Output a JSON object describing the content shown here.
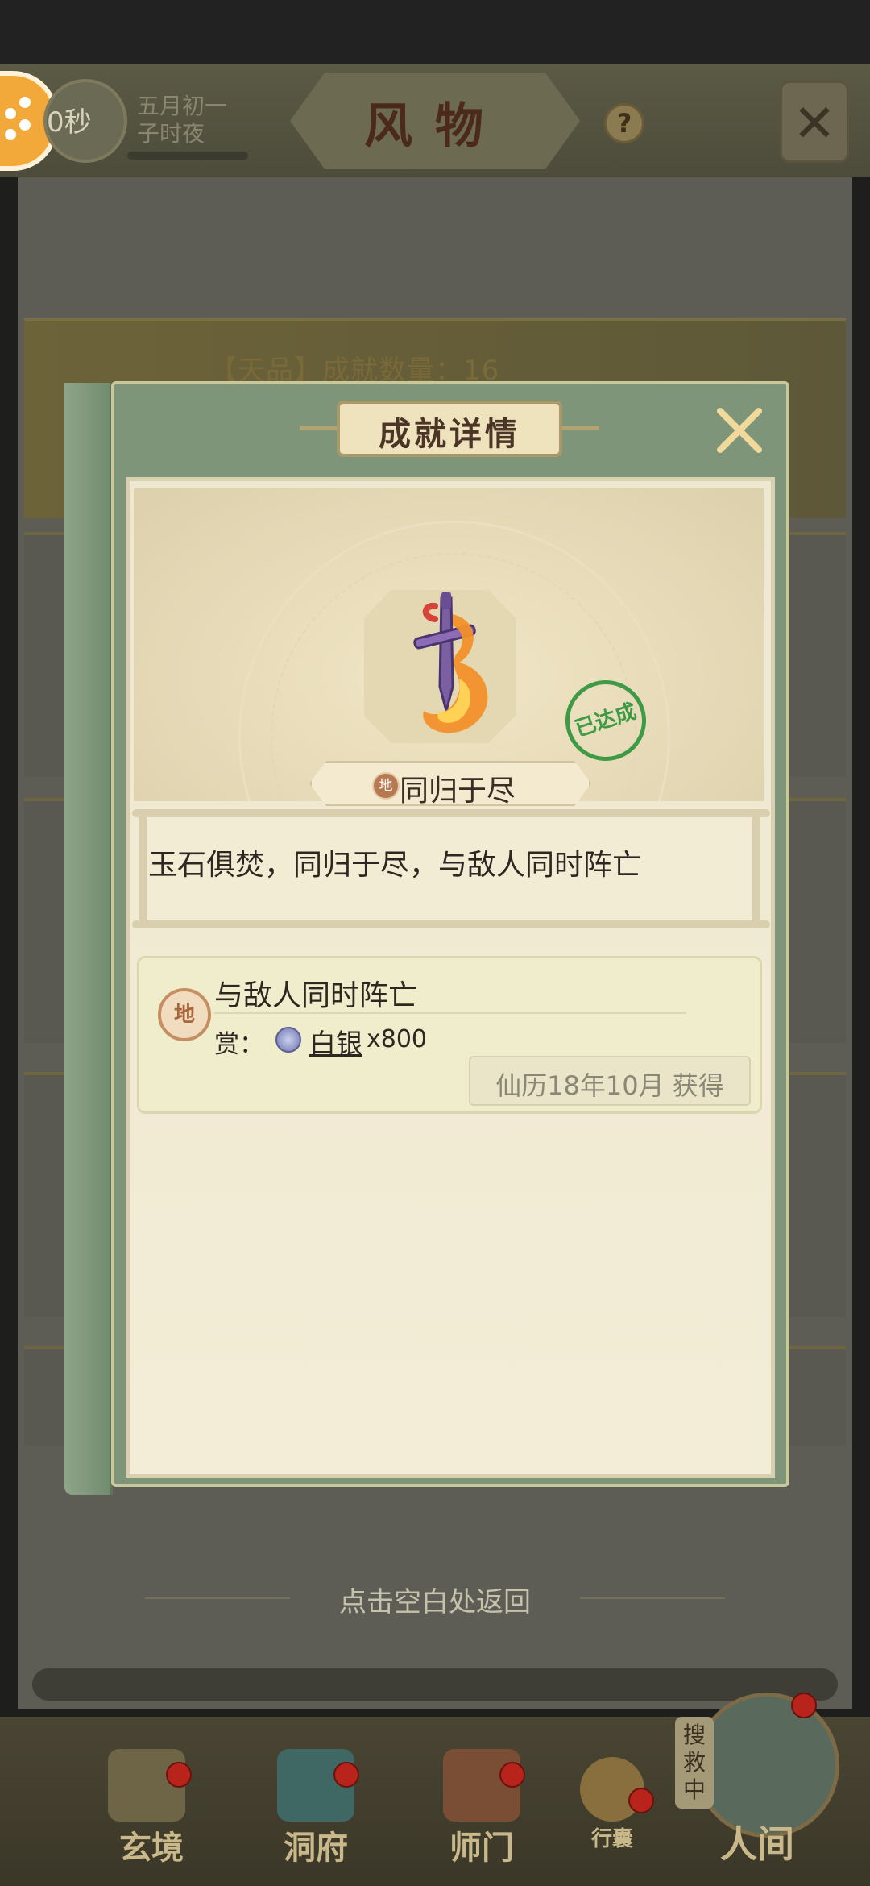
{
  "header": {
    "timer": "0秒",
    "date_line1": "五月初一",
    "date_line2": "子时夜",
    "title": "风物",
    "help_label": "?",
    "close_icon": "close-icon"
  },
  "background": {
    "card_text": "【天品】成就数量：16",
    "hint": "点击空白处返回",
    "rescue_label": "搜救中"
  },
  "nav": {
    "items": [
      {
        "label": "玄境"
      },
      {
        "label": "洞府"
      },
      {
        "label": "师门"
      },
      {
        "label": "行囊"
      },
      {
        "label": "人间"
      }
    ]
  },
  "modal": {
    "title": "成就详情",
    "achievement": {
      "tier": "地",
      "name": "同归于尽",
      "status_stamp": "已达成",
      "description": "玉石俱焚，同归于尽，与敌人同时阵亡"
    },
    "reward": {
      "tier": "地",
      "title": "与敌人同时阵亡",
      "prefix": "赏：",
      "item": "白银",
      "quantity": "x800",
      "obtained": "仙历18年10月 获得"
    }
  },
  "colors": {
    "modal_green": "#7e9579",
    "parchment": "#efe8d1",
    "stamp_green": "#3e9a44",
    "tier_brown": "#b57a52"
  }
}
